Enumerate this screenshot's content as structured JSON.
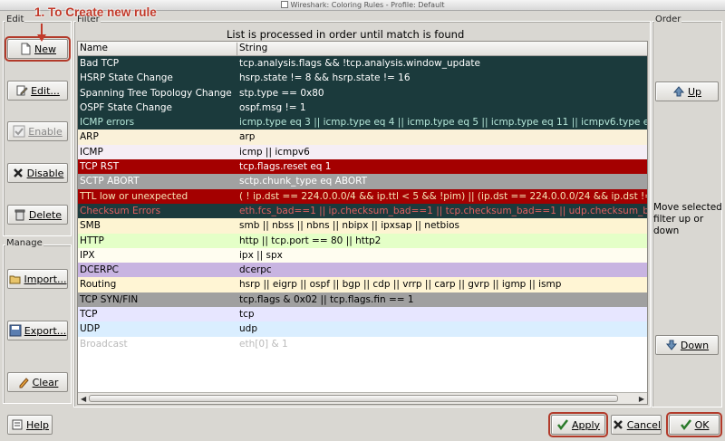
{
  "window": {
    "title": "Wireshark: Coloring Rules - Profile: Default"
  },
  "annotation": {
    "text": "1. To Create new rule"
  },
  "groups": {
    "edit": "Edit",
    "manage": "Manage",
    "filter": "Filter",
    "order": "Order"
  },
  "buttons": {
    "new": "New",
    "edit": "Edit...",
    "enable": "Enable",
    "disable": "Disable",
    "delete": "Delete",
    "import": "Import...",
    "export": "Export...",
    "clear": "Clear",
    "up": "Up",
    "down": "Down",
    "help": "Help",
    "apply": "Apply",
    "cancel": "Cancel",
    "ok": "OK"
  },
  "list": {
    "caption": "List is processed in order until match is found",
    "columns": [
      "Name",
      "String"
    ],
    "rows": [
      {
        "name": "Bad TCP",
        "string": "tcp.analysis.flags && !tcp.analysis.window_update",
        "bg": "#1b3a3c",
        "fg": "#ffffff"
      },
      {
        "name": "HSRP State Change",
        "string": "hsrp.state != 8 && hsrp.state != 16",
        "bg": "#1b3a3c",
        "fg": "#ffffff"
      },
      {
        "name": "Spanning Tree Topology  Change",
        "string": "stp.type == 0x80",
        "bg": "#1b3a3c",
        "fg": "#ffffff"
      },
      {
        "name": "OSPF State Change",
        "string": "ospf.msg != 1",
        "bg": "#1b3a3c",
        "fg": "#ffffff"
      },
      {
        "name": "ICMP errors",
        "string": "icmp.type eq 3 || icmp.type eq 4 || icmp.type eq 5 || icmp.type eq 11 || icmpv6.type eq",
        "bg": "#1b3a3c",
        "fg": "#b5e6d8"
      },
      {
        "name": "ARP",
        "string": "arp",
        "bg": "#faf1d9",
        "fg": "#000000"
      },
      {
        "name": "ICMP",
        "string": "icmp || icmpv6",
        "bg": "#f5eef5",
        "fg": "#000000"
      },
      {
        "name": "TCP RST",
        "string": "tcp.flags.reset eq 1",
        "bg": "#a40000",
        "fg": "#ffffff"
      },
      {
        "name": "SCTP ABORT",
        "string": "sctp.chunk_type eq ABORT",
        "bg": "#a1a1a1",
        "fg": "#ffffff"
      },
      {
        "name": "TTL low or unexpected",
        "string": "( ! ip.dst == 224.0.0.0/4 && ip.ttl < 5 && !pim) || (ip.dst == 224.0.0.0/24 && ip.dst !=",
        "bg": "#a40000",
        "fg": "#f6e4b5"
      },
      {
        "name": "Checksum Errors",
        "string": "eth.fcs_bad==1 || ip.checksum_bad==1 || tcp.checksum_bad==1 || udp.checksum_bad==",
        "bg": "#1b3a3c",
        "fg": "#e06060"
      },
      {
        "name": "SMB",
        "string": "smb || nbss || nbns || nbipx || ipxsap || netbios",
        "bg": "#fdf4d2",
        "fg": "#000000"
      },
      {
        "name": "HTTP",
        "string": "http || tcp.port == 80 || http2",
        "bg": "#e4ffc7",
        "fg": "#000000"
      },
      {
        "name": "IPX",
        "string": "ipx || spx",
        "bg": "#fffdf0",
        "fg": "#000000"
      },
      {
        "name": "DCERPC",
        "string": "dcerpc",
        "bg": "#c8b4e1",
        "fg": "#000000"
      },
      {
        "name": "Routing",
        "string": "hsrp || eigrp || ospf || bgp || cdp || vrrp || carp || gvrp || igmp || ismp",
        "bg": "#fff5d4",
        "fg": "#000000"
      },
      {
        "name": "TCP SYN/FIN",
        "string": "tcp.flags & 0x02 || tcp.flags.fin == 1",
        "bg": "#a0a0a0",
        "fg": "#000000"
      },
      {
        "name": "TCP",
        "string": "tcp",
        "bg": "#e7e6ff",
        "fg": "#000000"
      },
      {
        "name": "UDP",
        "string": "udp",
        "bg": "#daeeff",
        "fg": "#000000"
      },
      {
        "name": "Broadcast",
        "string": "eth[0] & 1",
        "bg": "#ffffff",
        "fg": "#bababa"
      }
    ]
  },
  "order": {
    "hint": "Move selected filter up or down"
  }
}
